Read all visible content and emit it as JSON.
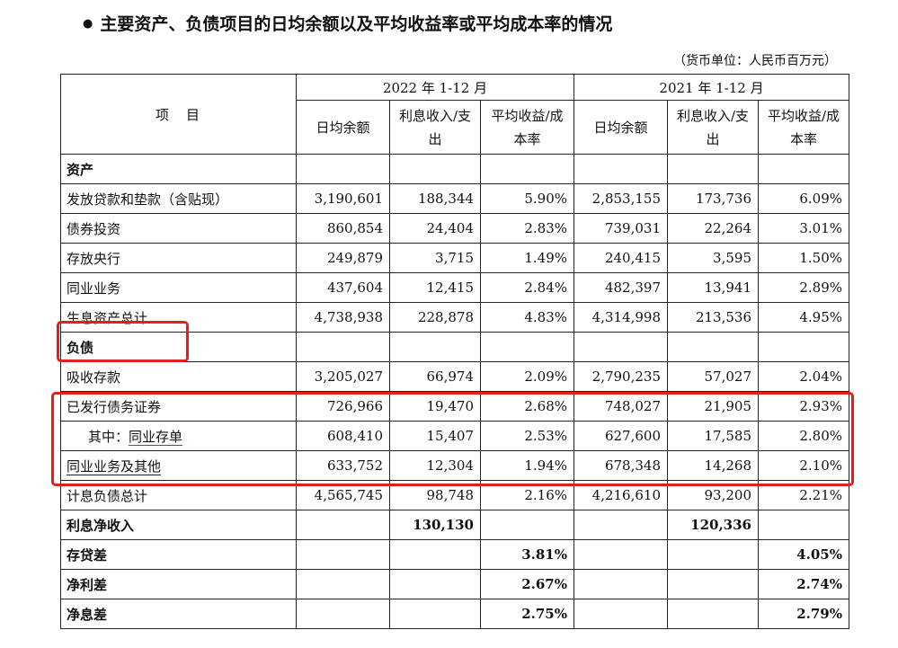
{
  "heading": {
    "bullet": "●",
    "title": "主要资产、负债项目的日均余额以及平均收益率或平均成本率的情况"
  },
  "unit_note": "（货币单位：人民币百万元）",
  "table": {
    "header": {
      "item": "项　目",
      "period1": "2022 年 1-12 月",
      "period2": "2021 年 1-12 月",
      "cols": [
        "日均余额",
        "利息收入/支出",
        "平均收益/成本率",
        "日均余额",
        "利息收入/支出",
        "平均收益/成本率"
      ]
    },
    "rows": [
      {
        "label": "资产",
        "section": true,
        "values": [
          "",
          "",
          "",
          "",
          "",
          ""
        ]
      },
      {
        "label": "发放贷款和垫款（含贴现）",
        "values": [
          "3,190,601",
          "188,344",
          "5.90%",
          "2,853,155",
          "173,736",
          "6.09%"
        ]
      },
      {
        "label": "债券投资",
        "values": [
          "860,854",
          "24,404",
          "2.83%",
          "739,031",
          "22,264",
          "3.01%"
        ]
      },
      {
        "label": "存放央行",
        "values": [
          "249,879",
          "3,715",
          "1.49%",
          "240,415",
          "3,595",
          "1.50%"
        ]
      },
      {
        "label": "同业业务",
        "values": [
          "437,604",
          "12,415",
          "2.84%",
          "482,397",
          "13,941",
          "2.89%"
        ]
      },
      {
        "label": "生息资产总计",
        "values": [
          "4,738,938",
          "228,878",
          "4.83%",
          "4,314,998",
          "213,536",
          "4.95%"
        ]
      },
      {
        "label": "负债",
        "section": true,
        "values": [
          "",
          "",
          "",
          "",
          "",
          ""
        ]
      },
      {
        "label": "吸收存款",
        "values": [
          "3,205,027",
          "66,974",
          "2.09%",
          "2,790,235",
          "57,027",
          "2.04%"
        ]
      },
      {
        "label": "已发行债务证券",
        "values": [
          "726,966",
          "19,470",
          "2.68%",
          "748,027",
          "21,905",
          "2.93%"
        ]
      },
      {
        "label_prefix": "其中：",
        "label": "同业存单",
        "sub": true,
        "values": [
          "608,410",
          "15,407",
          "2.53%",
          "627,600",
          "17,585",
          "2.80%"
        ]
      },
      {
        "label": "同业业务及其他",
        "values": [
          "633,752",
          "12,304",
          "1.94%",
          "678,348",
          "14,268",
          "2.10%"
        ]
      },
      {
        "label": "计息负债总计",
        "values": [
          "4,565,745",
          "98,748",
          "2.16%",
          "4,216,610",
          "93,200",
          "2.21%"
        ]
      },
      {
        "label": "利息净收入",
        "summary": true,
        "values": [
          "",
          "130,130",
          "",
          "",
          "120,336",
          ""
        ]
      },
      {
        "label": "存贷差",
        "summary": true,
        "values": [
          "",
          "",
          "3.81%",
          "",
          "",
          "4.05%"
        ]
      },
      {
        "label": "净利差",
        "summary": true,
        "values": [
          "",
          "",
          "2.67%",
          "",
          "",
          "2.74%"
        ]
      },
      {
        "label": "净息差",
        "summary": true,
        "values": [
          "",
          "",
          "2.75%",
          "",
          "",
          "2.79%"
        ]
      }
    ]
  },
  "highlight_color": "#e02020"
}
